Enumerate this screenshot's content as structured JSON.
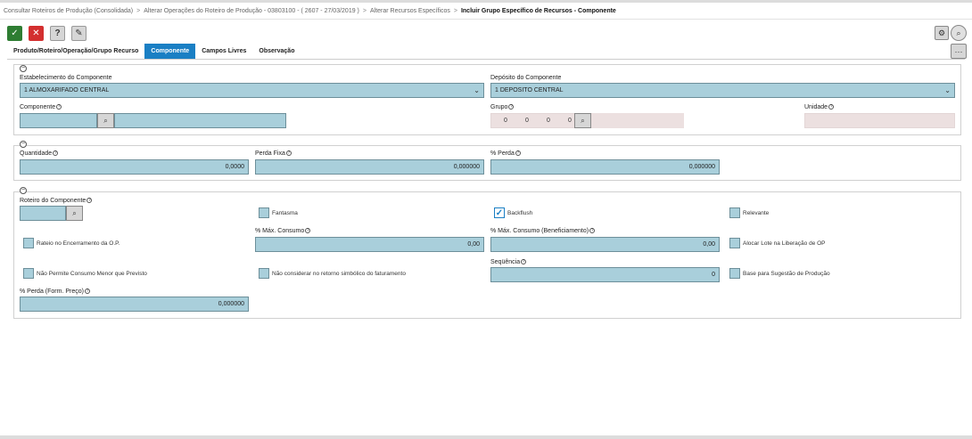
{
  "breadcrumb": {
    "items": [
      "Consultar Roteiros de Produção (Consolidada)",
      "Alterar Operações do Roteiro de Produção - 03803100 - ( 2607 - 27/03/2019 )",
      "Alterar Recursos Específicos"
    ],
    "separator": ">",
    "current": "Incluir Grupo Específico de Recursos - Componente"
  },
  "toolbar": {
    "confirm_icon": "✓",
    "cancel_icon": "✕",
    "help_icon": "?",
    "pin_icon": "✎",
    "settings_icon": "⚙",
    "search_icon": "⌕",
    "more_icon": "···"
  },
  "tabs": [
    {
      "label": "Produto/Roteiro/Operação/Grupo Recurso",
      "active": false
    },
    {
      "label": "Componente",
      "active": true
    },
    {
      "label": "Campos Livres",
      "active": false
    },
    {
      "label": "Observação",
      "active": false
    }
  ],
  "section1": {
    "collapse_symbol": "−",
    "estabelecimento": {
      "label": "Estabelecimento do Componente",
      "value": "1 ALMOXARIFADO CENTRAL"
    },
    "deposito": {
      "label": "Depósito do Componente",
      "value": "1 DEPOSITO CENTRAL"
    },
    "componente": {
      "label": "Componente",
      "value": "",
      "description": ""
    },
    "grupo": {
      "label": "Grupo",
      "values": [
        "0",
        "0",
        "0",
        "0"
      ],
      "description": ""
    },
    "unidade": {
      "label": "Unidade",
      "value": ""
    }
  },
  "section2": {
    "collapse_symbol": "−",
    "quantidade": {
      "label": "Quantidade",
      "value": "0,0000"
    },
    "perda_fixa": {
      "label": "Perda Fixa",
      "value": "0,000000"
    },
    "perc_perda": {
      "label": "% Perda",
      "value": "0,000000"
    }
  },
  "section3": {
    "collapse_symbol": "−",
    "roteiro": {
      "label": "Roteiro do Componente",
      "value": ""
    },
    "fantasma": {
      "label": "Fantasma",
      "checked": false
    },
    "backflush": {
      "label": "Backflush",
      "checked": true
    },
    "relevante": {
      "label": "Relevante",
      "checked": false
    },
    "rateio": {
      "label": "Rateio no Encerramento da O.P.",
      "checked": false
    },
    "max_consumo": {
      "label": "% Máx. Consumo",
      "value": "0,00"
    },
    "max_consumo_benef": {
      "label": "% Máx. Consumo (Beneficiamento)",
      "value": "0,00"
    },
    "alocar_lote": {
      "label": "Alocar Lote na Liberação de OP",
      "checked": false
    },
    "nao_permite": {
      "label": "Não Permite Consumo Menor que Previsto",
      "checked": false
    },
    "nao_considerar": {
      "label": "Não considerar no retorno simbólico do faturamento",
      "checked": false
    },
    "sequencia": {
      "label": "Seqüência",
      "value": "0"
    },
    "base_sugestao": {
      "label": "Base para Sugestão de Produção",
      "checked": false
    },
    "perda_form": {
      "label": "% Perda (Form. Preço)",
      "value": "0,000000"
    }
  },
  "colors": {
    "accent": "#1a7fc4",
    "field": "#a9cfdb",
    "readonly": "#ece0e0",
    "ok": "#2e7d32",
    "cancel": "#d32f2f"
  }
}
